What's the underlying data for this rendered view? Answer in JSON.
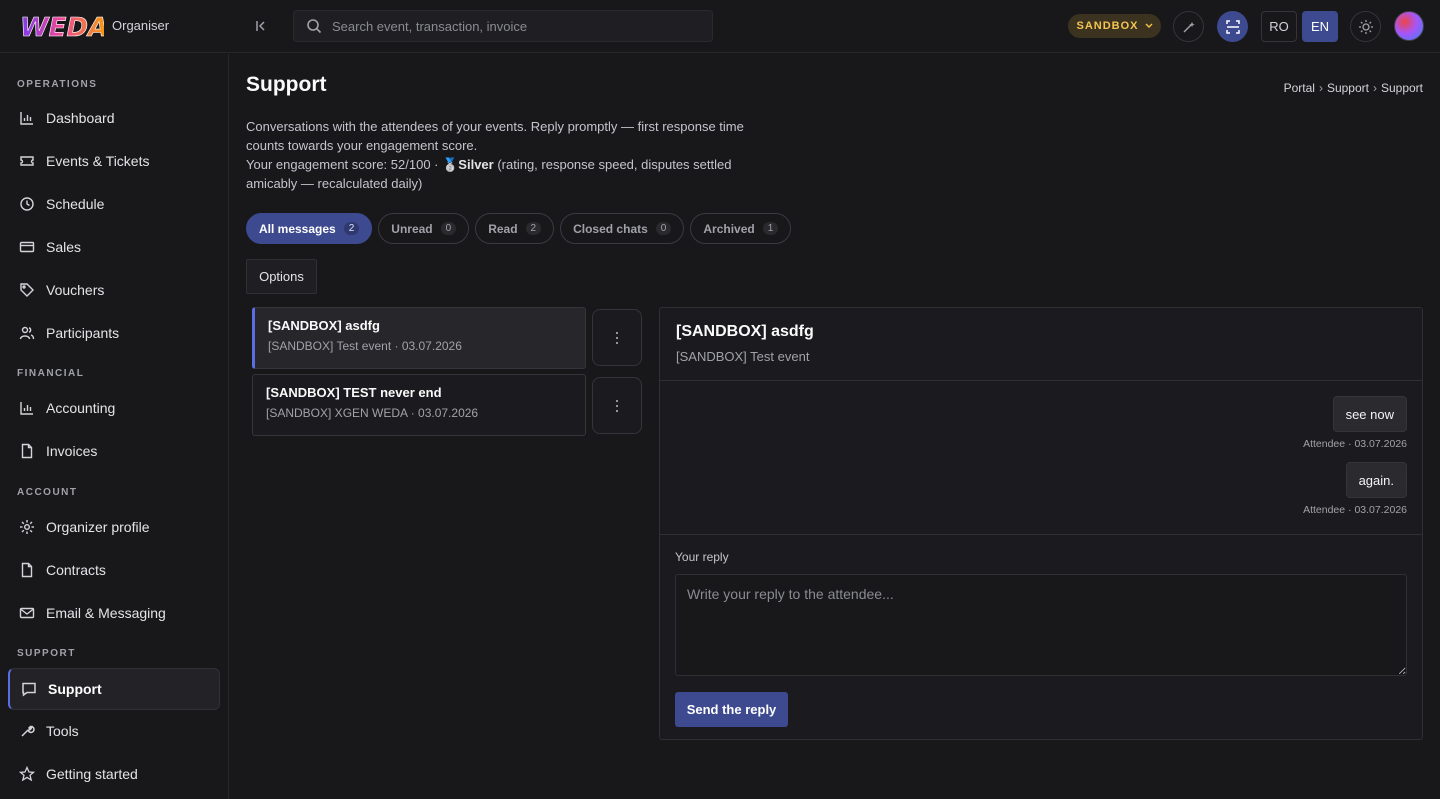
{
  "app": {
    "logo_text": "WEDA",
    "context_label": "Organiser"
  },
  "search": {
    "placeholder": "Search event, transaction, invoice"
  },
  "topbar": {
    "environment_badge": "SANDBOX",
    "languages": [
      "RO",
      "EN"
    ],
    "active_language": "EN",
    "accent_color": "#3e4a8f",
    "badge_color": "#f5c451"
  },
  "sidebar": {
    "sections": [
      {
        "title": "OPERATIONS",
        "items": [
          {
            "label": "Dashboard",
            "icon": "chart-bar-icon"
          },
          {
            "label": "Events & Tickets",
            "icon": "ticket-icon"
          },
          {
            "label": "Schedule",
            "icon": "clock-icon"
          },
          {
            "label": "Sales",
            "icon": "credit-card-icon"
          },
          {
            "label": "Vouchers",
            "icon": "tag-icon"
          },
          {
            "label": "Participants",
            "icon": "users-icon"
          }
        ]
      },
      {
        "title": "FINANCIAL",
        "items": [
          {
            "label": "Accounting",
            "icon": "chart-bar-icon"
          },
          {
            "label": "Invoices",
            "icon": "document-icon"
          }
        ]
      },
      {
        "title": "ACCOUNT",
        "items": [
          {
            "label": "Organizer profile",
            "icon": "gear-icon"
          },
          {
            "label": "Contracts",
            "icon": "document-icon"
          },
          {
            "label": "Email & Messaging",
            "icon": "mail-icon"
          }
        ]
      },
      {
        "title": "SUPPORT",
        "items": [
          {
            "label": "Support",
            "icon": "chat-icon",
            "active": true
          },
          {
            "label": "Tools",
            "icon": "wrench-icon"
          },
          {
            "label": "Getting started",
            "icon": "star-icon"
          }
        ]
      }
    ]
  },
  "page": {
    "title": "Support",
    "breadcrumb": [
      "Portal",
      "Support",
      "Support"
    ],
    "breadcrumb_sep": "›",
    "description_line1": "Conversations with the attendees of your events. Reply promptly — first response time counts towards your engagement score.",
    "score_prefix": "Your engagement score: 52/100 · ",
    "score_medal": "🥈",
    "score_tier": "Silver",
    "score_suffix": " (rating, response speed, disputes settled amicably — recalculated daily)"
  },
  "tabs": [
    {
      "label": "All messages",
      "count": "2",
      "active": true
    },
    {
      "label": "Unread",
      "count": "0"
    },
    {
      "label": "Read",
      "count": "2"
    },
    {
      "label": "Closed chats",
      "count": "0"
    },
    {
      "label": "Archived",
      "count": "1"
    }
  ],
  "options_label": "Options",
  "conversations": [
    {
      "title": "[SANDBOX] asdfg",
      "subtitle": "[SANDBOX] Test event · 03.07.2026",
      "active": true
    },
    {
      "title": "[SANDBOX] TEST never end",
      "subtitle": "[SANDBOX] XGEN WEDA · 03.07.2026"
    }
  ],
  "chat": {
    "title": "[SANDBOX] asdfg",
    "subtitle": "[SANDBOX] Test event",
    "messages": [
      {
        "text": "see now",
        "meta": "Attendee · 03.07.2026"
      },
      {
        "text": "again.",
        "meta": "Attendee · 03.07.2026"
      }
    ],
    "reply_label": "Your reply",
    "reply_placeholder": "Write your reply to the attendee...",
    "send_label": "Send the reply"
  }
}
